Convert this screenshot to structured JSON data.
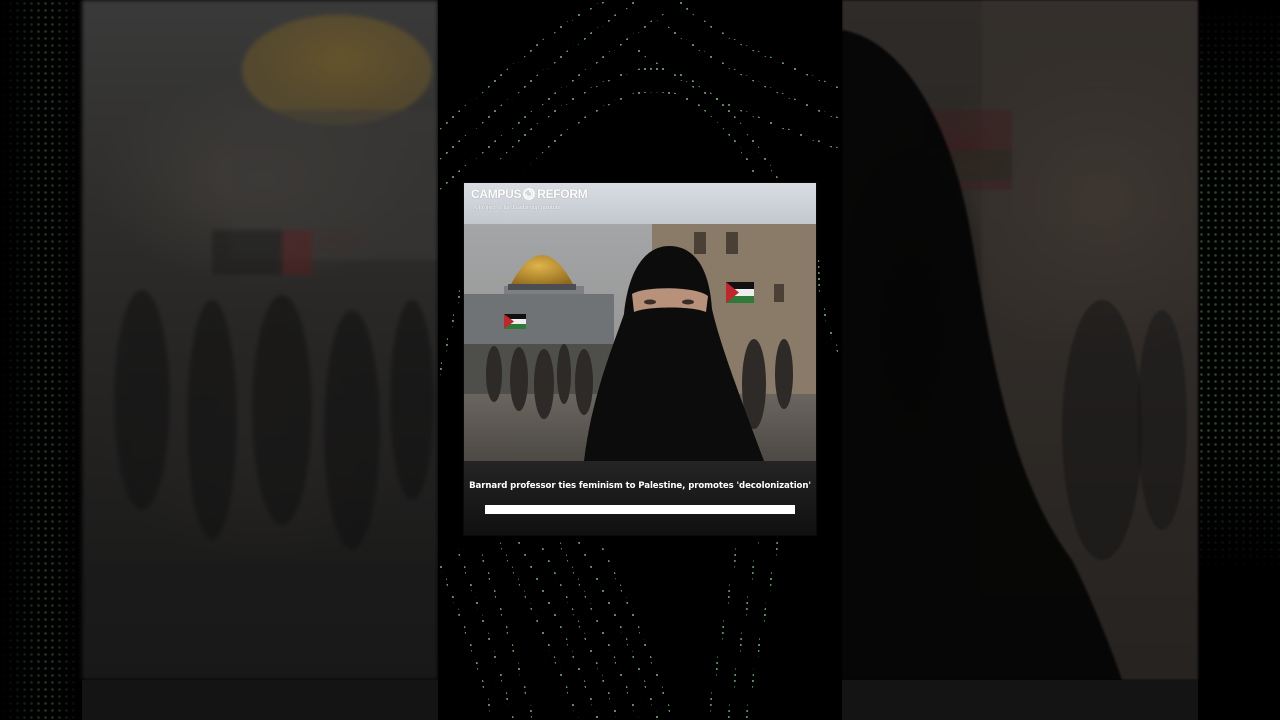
{
  "card": {
    "brand": {
      "name_left": "CAMPUS",
      "name_right": "REFORM",
      "tagline": "A Project of the Leadership Institute"
    },
    "headline": "Barnard professor ties feminism to Palestine, promotes 'decolonization'",
    "progress": 1.0
  },
  "colors": {
    "accent_dots": "#7fdc7f",
    "background": "#000000",
    "header_bg": "#d4d8de"
  },
  "icons": {
    "logo_mark": "campus-reform-swirl-icon"
  }
}
